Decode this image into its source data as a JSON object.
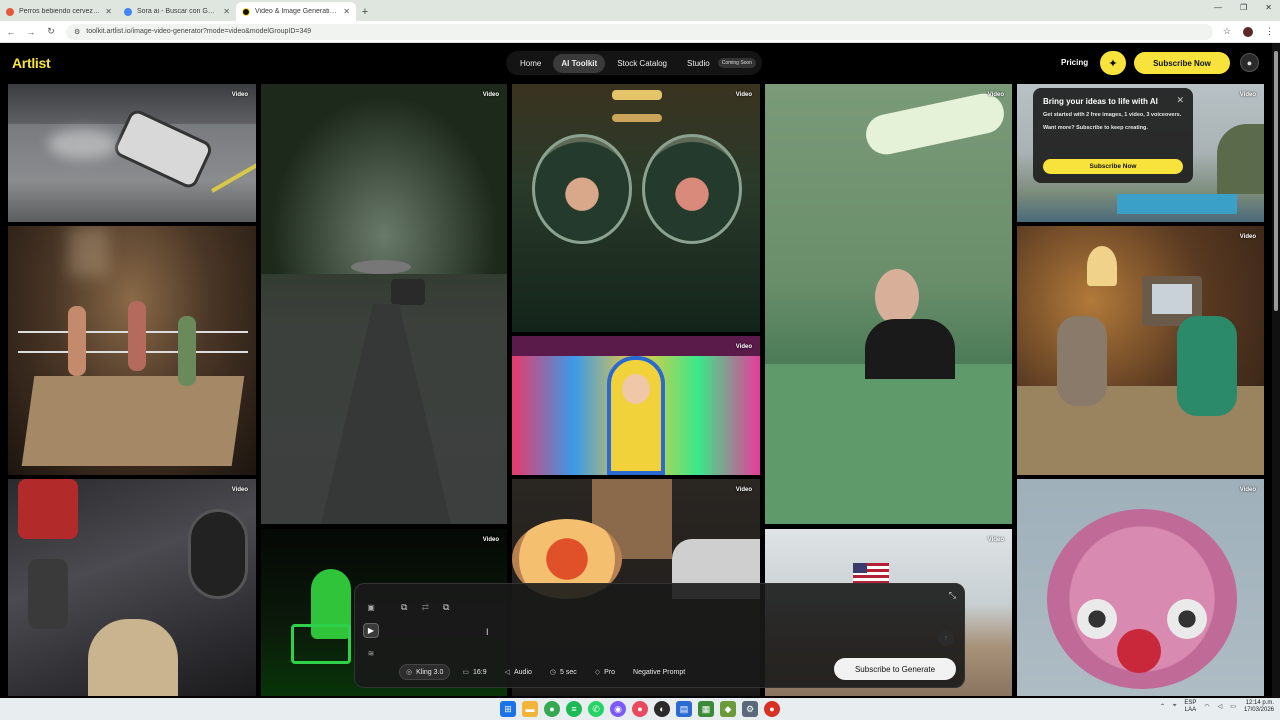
{
  "browser": {
    "tabs": [
      {
        "title": "Perros bebiendo cerveza con c...",
        "active": false
      },
      {
        "title": "Sora ai - Buscar con Google",
        "active": false
      },
      {
        "title": "Video & Image Generation - AI...",
        "active": true
      }
    ],
    "url": "toolkit.artlist.io/image-video-generator?mode=video&modelGroupID=349"
  },
  "header": {
    "logo": "Artlist",
    "nav": [
      {
        "label": "Home",
        "active": false
      },
      {
        "label": "AI Toolkit",
        "active": true
      },
      {
        "label": "Stock Catalog",
        "active": false
      },
      {
        "label": "Studio",
        "active": false
      }
    ],
    "studio_badge": "Coming Soon",
    "pricing": "Pricing",
    "subscribe": "Subscribe Now"
  },
  "gallery": {
    "tag": "Video"
  },
  "promo": {
    "title": "Bring your ideas to life with AI",
    "line1": "Get started with 2 free images, 1 video, 3 voiceovers.",
    "line2": "Want more? Subscribe to keep creating.",
    "cta": "Subscribe Now"
  },
  "generator": {
    "model": "Kling 3.0",
    "aspect": "16:9",
    "audio": "Audio",
    "duration": "5 sec",
    "quality": "Pro",
    "negative": "Negative Prompt",
    "generate": "Subscribe to Generate"
  },
  "taskbar": {
    "lang_top": "ESP",
    "lang_bottom": "LAA",
    "time": "12:14 p.m.",
    "date": "17/03/2026"
  },
  "colors": {
    "accent": "#f7e33b",
    "background": "#000000"
  }
}
